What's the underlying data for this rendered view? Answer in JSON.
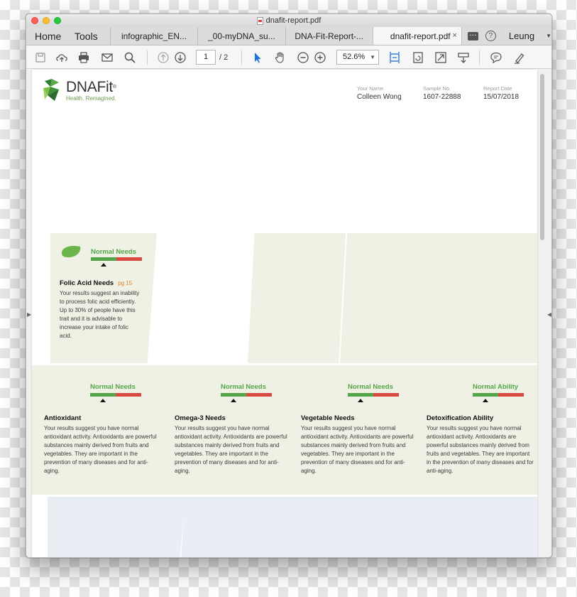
{
  "window": {
    "title": "dnafit-report.pdf"
  },
  "tabs": {
    "home": "Home",
    "tools": "Tools",
    "documents": [
      {
        "label": "infographic_EN..."
      },
      {
        "label": "_00-myDNA_su..."
      },
      {
        "label": "DNA-Fit-Report-..."
      },
      {
        "label": "dnafit-report.pdf"
      }
    ],
    "close_symbol": "×",
    "user": "Leung"
  },
  "toolbar": {
    "page_current": "1",
    "page_total": "/ 2",
    "zoom": "52.6%",
    "icons": [
      "save-icon",
      "upload-icon",
      "print-icon",
      "mail-icon",
      "search-icon",
      "page-up-icon",
      "page-down-icon",
      "select-arrow-icon",
      "hand-icon",
      "zoom-out-icon",
      "zoom-in-icon",
      "fit-width-icon",
      "rotate-icon",
      "fullscreen-icon",
      "scroll-mode-icon",
      "comment-icon",
      "highlight-icon"
    ]
  },
  "report": {
    "brand": "DNAFit",
    "brand_mark": "®",
    "tagline": "Health. Remagined.",
    "fields": [
      {
        "label": "Your Name",
        "value": "Colleen Wong"
      },
      {
        "label": "Sample No.",
        "value": "1607-22888"
      },
      {
        "label": "Report Date",
        "value": "15/07/2018"
      }
    ],
    "cards": [
      {
        "status": "Normal Needs",
        "title": "Folic Acid Needs",
        "page_ref": "pg 15",
        "body": "Your results suggest an inability to process folic acid efficiently. Up to 30% of people have this trait and it is advisable to increase your intake of folic acid."
      },
      {
        "status": "Normal Needs",
        "title": "Antioxidant",
        "body": "Your results suggest you have normal antioxidant activity. Antioxidants are powerful substances mainly derived from fruits and vegetables. They are important in the prevention of many diseases and for anti-aging."
      },
      {
        "status": "Normal Needs",
        "title": "Omega-3 Needs",
        "body": "Your results suggest you have normal antioxidant activity. Antioxidants are powerful substances mainly derived from fruits and vegetables. They are important in the prevention of many diseases and for anti-aging."
      },
      {
        "status": "Normal Needs",
        "title": "Vegetable Needs",
        "body": "Your results suggest you have normal antioxidant activity. Antioxidants are powerful substances mainly derived from fruits and vegetables. They are important in the prevention of many diseases and for anti-aging."
      },
      {
        "status": "Normal Ability",
        "title": "Detoxification Ability",
        "body": "Your results suggest you have normal antioxidant activity. Antioxidants are powerful substances mainly derived from fruits and vegetables. They are important in the prevention of many diseases and for anti-aging."
      }
    ]
  },
  "colors": {
    "accent_green": "#55a64b",
    "accent_red": "#d84a41",
    "panel_green": "#eef1e3",
    "panel_blue": "#e8eef4",
    "page_ref_orange": "#e0812a"
  }
}
